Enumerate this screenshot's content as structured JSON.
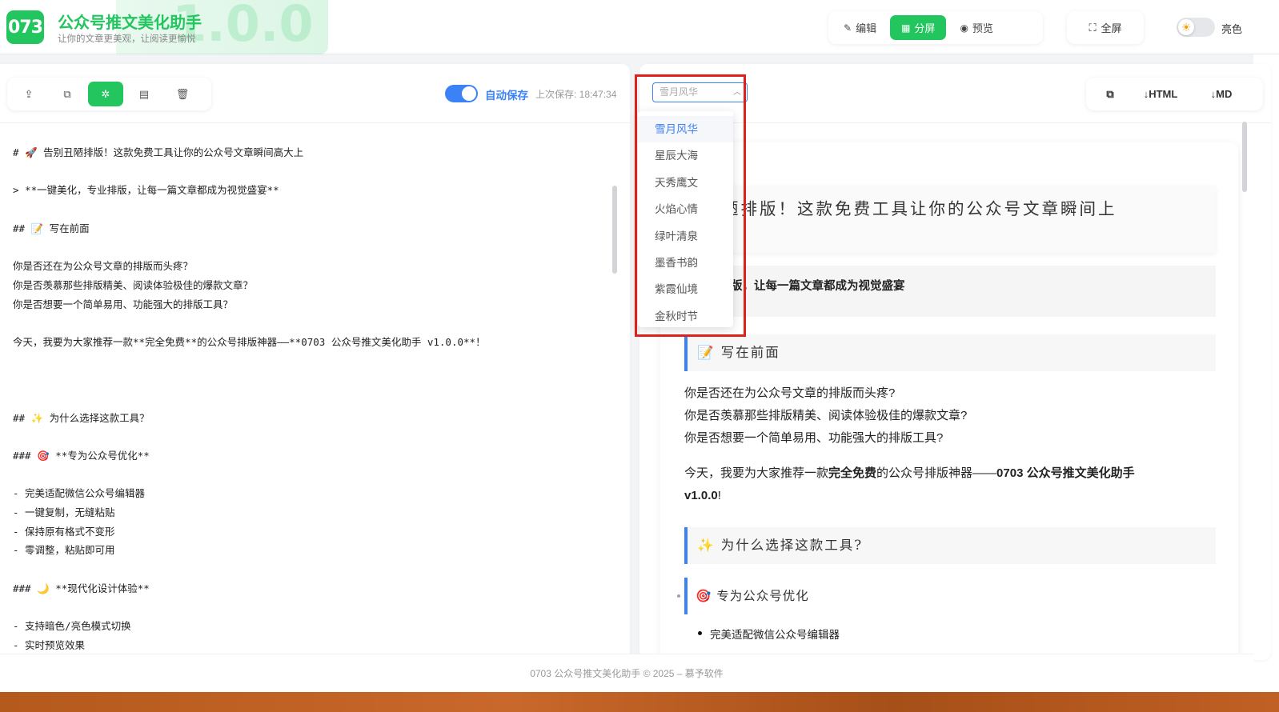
{
  "header": {
    "logo_text": "073",
    "watermark": "1.0.0",
    "title": "公众号推文美化助手",
    "subtitle": "让你的文章更美观，让阅读更愉悦",
    "modes": [
      {
        "icon": "✎",
        "label": "编辑"
      },
      {
        "icon": "▦",
        "label": "分屏"
      },
      {
        "icon": "◉",
        "label": "预览"
      }
    ],
    "active_mode": "分屏",
    "fullscreen": {
      "icon": "⛶",
      "label": "全屏"
    },
    "theme_label": "亮色",
    "accent_color": "#22c55e"
  },
  "editor": {
    "tools": [
      "upload-icon",
      "copy-icon",
      "magic-icon",
      "document-icon",
      "trash-icon"
    ],
    "autosave_label": "自动保存",
    "last_save": "上次保存: 18:47:34",
    "lines": [
      "# 🚀 告别丑陋排版！这款免费工具让你的公众号文章瞬间高大上",
      "",
      "> **一键美化，专业排版，让每一篇文章都成为视觉盛宴**",
      "",
      "## 📝 写在前面",
      "",
      "你是否还在为公众号文章的排版而头疼？",
      "你是否羡慕那些排版精美、阅读体验极佳的爆款文章？",
      "你是否想要一个简单易用、功能强大的排版工具？",
      "",
      "今天，我要为大家推荐一款**完全免费**的公众号排版神器——**0703 公众号推文美化助手 v1.0.0**！",
      "",
      "",
      "",
      "## ✨ 为什么选择这款工具？",
      "",
      "### 🎯 **专为公众号优化**",
      "",
      "- 完美适配微信公众号编辑器",
      "- 一键复制，无缝粘贴",
      "- 保持原有格式不变形",
      "- 零调整，粘贴即可用",
      "",
      "### 🌙 **现代化设计体验**",
      "",
      "- 支持暗色/亮色模式切换",
      "- 实时预览效果"
    ]
  },
  "preview": {
    "theme_select_value": "雪月风华",
    "theme_options": [
      "雪月风华",
      "星辰大海",
      "天秀鹰文",
      "火焰心情",
      "绿叶清泉",
      "墨香书韵",
      "紫霞仙境",
      "金秋时节"
    ],
    "export_buttons": [
      "⧉",
      "↓HTML",
      "↓MD"
    ],
    "h1": "别丑陋排版！这款免费工具让你的公众号文章瞬间上",
    "quote": "，专业排版，让每一篇文章都成为视觉盛宴",
    "h2_1": "📝 写在前面",
    "para_lines": [
      "你是否还在为公众号文章的排版而头疼?",
      "你是否羡慕那些排版精美、阅读体验极佳的爆款文章?",
      "你是否想要一个简单易用、功能强大的排版工具?"
    ],
    "para2_pre": "今天，我要为大家推荐一款",
    "para2_bold1": "完全免费",
    "para2_mid": "的公众号排版神器——",
    "para2_bold2": "0703 公众号推文美化助手",
    "para2_line2_bold": "v1.0.0",
    "para2_end": "!",
    "h2_2": "✨ 为什么选择这款工具?",
    "h3_1": "🎯 专为公众号优化",
    "li_1": "完美适配微信公众号编辑器"
  },
  "footer": {
    "text": "0703 公众号推文美化助手 © 2025 – 慕予软件"
  }
}
